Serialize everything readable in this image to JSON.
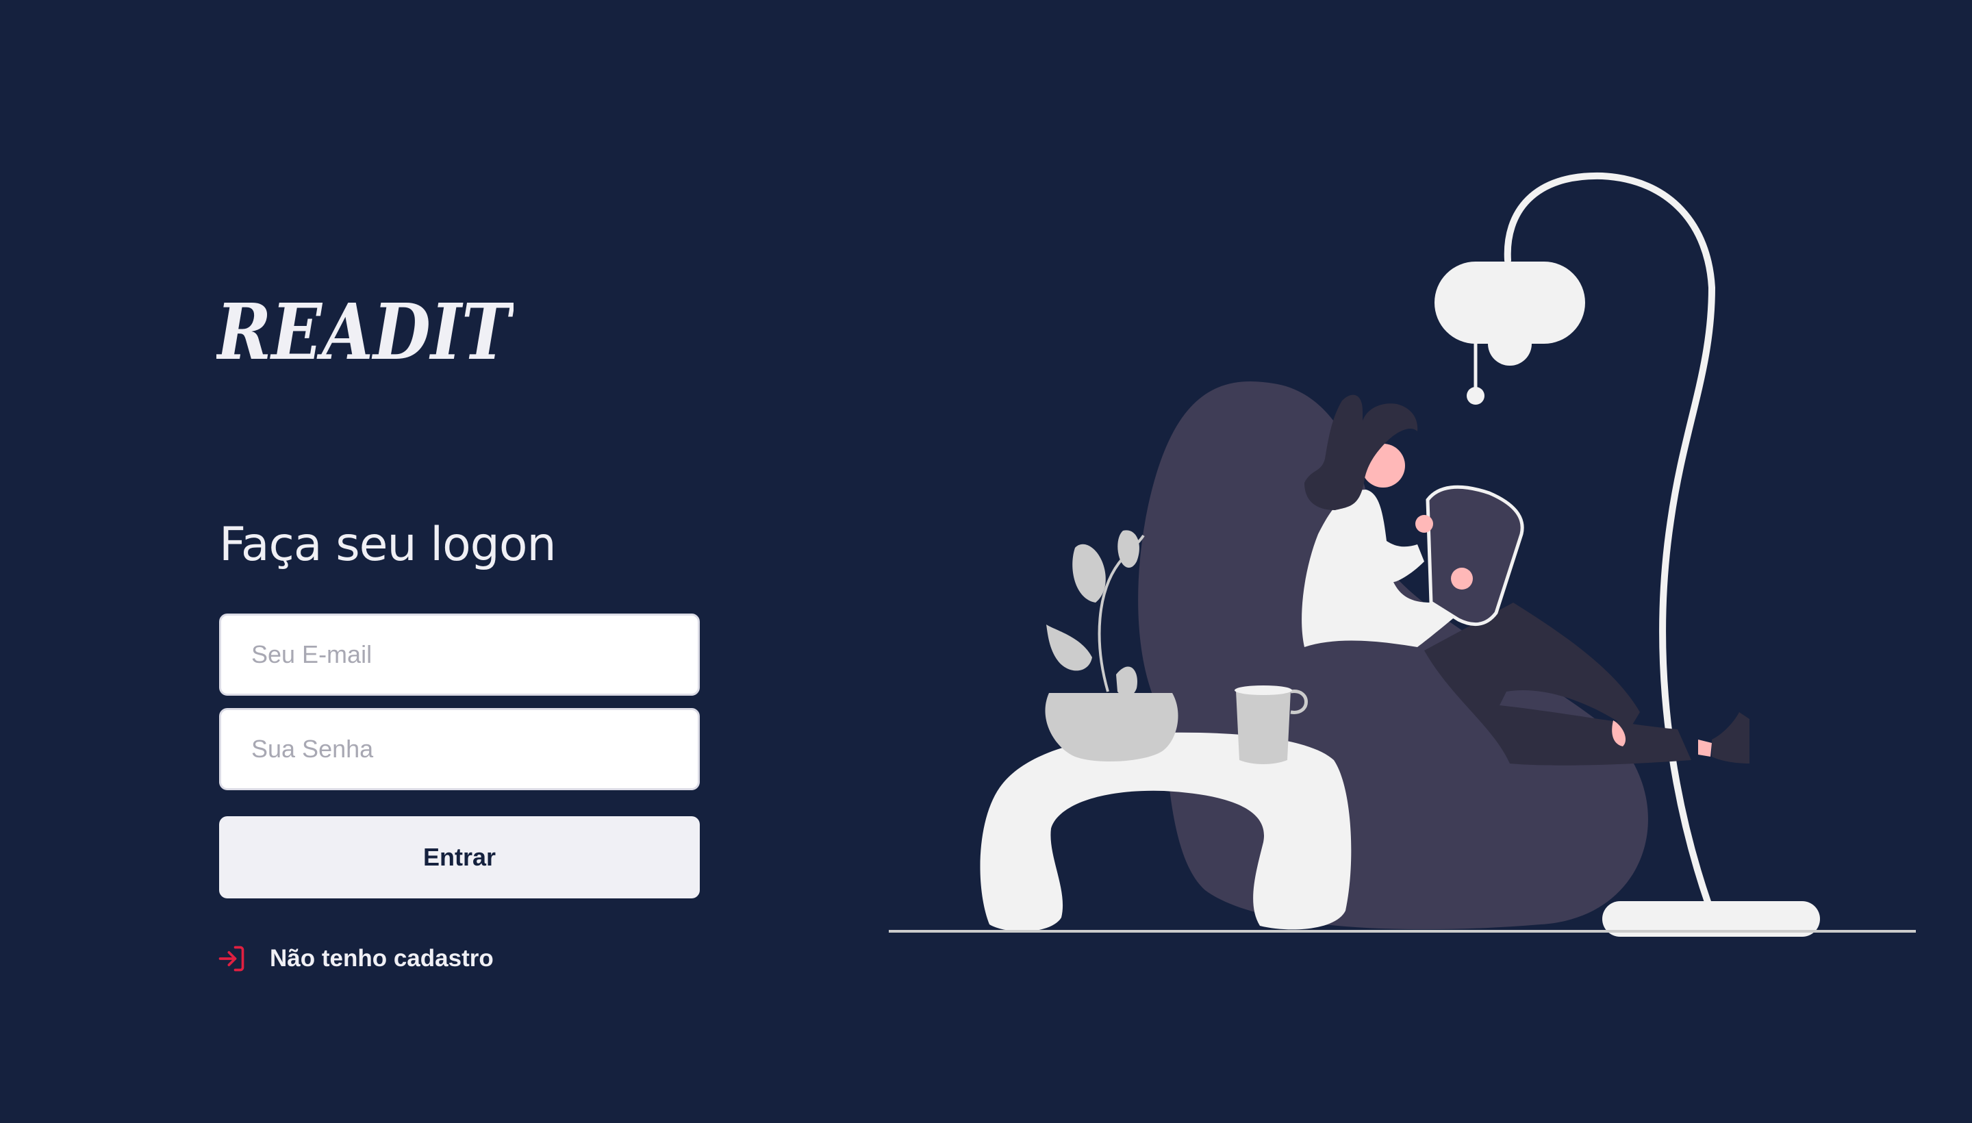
{
  "brand": {
    "name": "READIT"
  },
  "form": {
    "title": "Faça seu logon",
    "email_placeholder": "Seu E-mail",
    "password_placeholder": "Sua Senha",
    "submit_label": "Entrar"
  },
  "links": {
    "register_label": "Não tenho cadastro",
    "register_icon": "log-in-icon"
  },
  "illustration": {
    "subject": "woman-reading-on-beanbag"
  },
  "colors": {
    "background": "#15213E",
    "text": "#F0F0F5",
    "input_bg": "#FFFFFF",
    "placeholder": "#A8A8B3",
    "button_bg": "#F0F0F5",
    "button_text": "#15213E",
    "accent": "#E02041",
    "beanbag": "#3F3D56",
    "skin": "#FFB8B8",
    "furniture": "#F2F2F2",
    "plant": "#CCCCCC"
  }
}
